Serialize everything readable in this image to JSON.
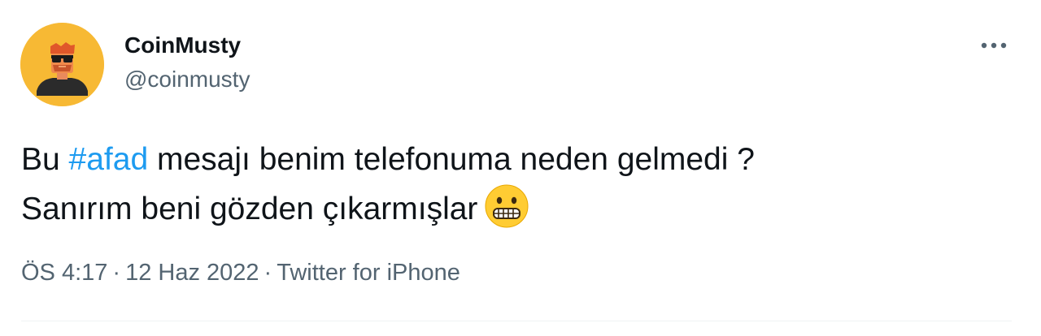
{
  "user": {
    "display_name": "CoinMusty",
    "handle": "@coinmusty",
    "avatar_icon": "avatar-illustration",
    "avatar_color": "#f7b934"
  },
  "menu": {
    "more_icon": "more-dots-icon"
  },
  "tweet": {
    "line1_before": "Bu ",
    "hashtag": "#afad",
    "line1_after": " mesajı benim telefonuma neden gelmedi ?",
    "line2": "Sanırım beni gözden çıkarmışlar",
    "emoji": "grimacing-face-emoji"
  },
  "meta": {
    "time": "ÖS 4:17",
    "separator1": "·",
    "date": "12 Haz 2022",
    "separator2": "·",
    "source": "Twitter for iPhone"
  },
  "colors": {
    "text": "#0f1419",
    "secondary": "#536471",
    "link": "#1d9bf0"
  }
}
